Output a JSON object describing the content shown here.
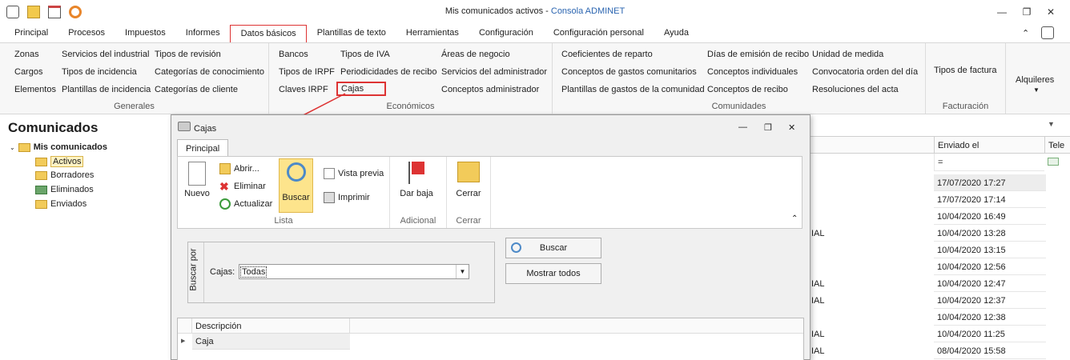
{
  "window": {
    "title": "Mis comunicados activos",
    "title_sep": " - ",
    "app": "Consola ADMINET"
  },
  "menu": [
    "Principal",
    "Procesos",
    "Impuestos",
    "Informes",
    "Datos básicos",
    "Plantillas de texto",
    "Herramientas",
    "Configuración",
    "Configuración personal",
    "Ayuda"
  ],
  "ribbon": {
    "generales": {
      "caption": "Generales",
      "col1": [
        "Zonas",
        "Cargos",
        "Elementos"
      ],
      "col2": [
        "Servicios del industrial",
        "Tipos de incidencia",
        "Plantillas de incidencia"
      ],
      "col3": [
        "Tipos de revisión",
        "Categorías de conocimiento",
        "Categorías de cliente"
      ]
    },
    "economicos": {
      "caption": "Económicos",
      "col1": [
        "Bancos",
        "Tipos de IRPF",
        "Claves IRPF"
      ],
      "col2": [
        "Tipos de IVA",
        "Periodicidades de recibo",
        "Cajas"
      ],
      "col3": [
        "Áreas de negocio",
        "Servicios del administrador",
        "Conceptos administrador"
      ]
    },
    "comunidades": {
      "caption": "Comunidades",
      "col1": [
        "Coeficientes de reparto",
        "Conceptos de gastos comunitarios",
        "Plantillas de gastos de la comunidad"
      ],
      "col2": [
        "Días de emisión de recibo",
        "Conceptos individuales",
        "Conceptos de recibo"
      ],
      "col3": [
        "Unidad de medida",
        "Convocatoria orden del día",
        "Resoluciones del acta"
      ]
    },
    "facturacion": {
      "caption": "Facturación",
      "item": "Tipos de factura"
    },
    "alquileres": {
      "label": "Alquileres"
    }
  },
  "left": {
    "title": "Comunicados",
    "root": "Mis comunicados",
    "items": [
      "Activos",
      "Borradores",
      "Eliminados",
      "Enviados"
    ]
  },
  "grid": {
    "col_enviado": "Enviado el",
    "col_tel": "Tele",
    "filter": "=",
    "rows": [
      "17/07/2020 17:27",
      "17/07/2020 17:14",
      "10/04/2020 16:49",
      "10/04/2020 13:28",
      "10/04/2020 13:15",
      "10/04/2020 12:56",
      "10/04/2020 12:47",
      "10/04/2020 12:37",
      "10/04/2020 12:38",
      "10/04/2020 11:25",
      "08/04/2020 15:58"
    ],
    "left_frag": [
      "IAL",
      "IAL",
      "IAL",
      "IAL",
      "IAL"
    ]
  },
  "dialog": {
    "title": "Cajas",
    "tab": "Principal",
    "lista": {
      "caption": "Lista",
      "nuevo": "Nuevo",
      "abrir": "Abrir...",
      "eliminar": "Eliminar",
      "actualizar": "Actualizar",
      "buscar": "Buscar",
      "vista_previa": "Vista previa",
      "imprimir": "Imprimir"
    },
    "adicional": {
      "caption": "Adicional",
      "dar_baja": "Dar baja"
    },
    "cerrar": {
      "caption": "Cerrar",
      "cerrar": "Cerrar"
    },
    "search": {
      "group_label": "Buscar por",
      "field_label": "Cajas:",
      "field_value": "Todas",
      "buscar_btn": "Buscar",
      "mostrar_btn": "Mostrar todos"
    },
    "table": {
      "header": "Descripción",
      "rows": [
        "Caja"
      ]
    }
  },
  "colors": {
    "highlight": "#dd3333",
    "accent": "#2a64b0"
  }
}
